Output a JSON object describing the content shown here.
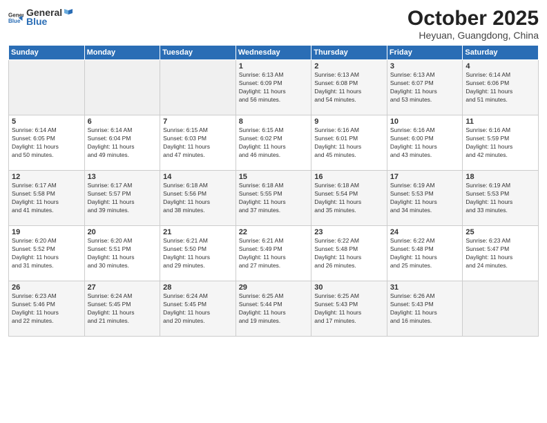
{
  "logo": {
    "general": "General",
    "blue": "Blue"
  },
  "header": {
    "month": "October 2025",
    "location": "Heyuan, Guangdong, China"
  },
  "weekdays": [
    "Sunday",
    "Monday",
    "Tuesday",
    "Wednesday",
    "Thursday",
    "Friday",
    "Saturday"
  ],
  "weeks": [
    [
      {
        "num": "",
        "info": ""
      },
      {
        "num": "",
        "info": ""
      },
      {
        "num": "",
        "info": ""
      },
      {
        "num": "1",
        "info": "Sunrise: 6:13 AM\nSunset: 6:09 PM\nDaylight: 11 hours\nand 56 minutes."
      },
      {
        "num": "2",
        "info": "Sunrise: 6:13 AM\nSunset: 6:08 PM\nDaylight: 11 hours\nand 54 minutes."
      },
      {
        "num": "3",
        "info": "Sunrise: 6:13 AM\nSunset: 6:07 PM\nDaylight: 11 hours\nand 53 minutes."
      },
      {
        "num": "4",
        "info": "Sunrise: 6:14 AM\nSunset: 6:06 PM\nDaylight: 11 hours\nand 51 minutes."
      }
    ],
    [
      {
        "num": "5",
        "info": "Sunrise: 6:14 AM\nSunset: 6:05 PM\nDaylight: 11 hours\nand 50 minutes."
      },
      {
        "num": "6",
        "info": "Sunrise: 6:14 AM\nSunset: 6:04 PM\nDaylight: 11 hours\nand 49 minutes."
      },
      {
        "num": "7",
        "info": "Sunrise: 6:15 AM\nSunset: 6:03 PM\nDaylight: 11 hours\nand 47 minutes."
      },
      {
        "num": "8",
        "info": "Sunrise: 6:15 AM\nSunset: 6:02 PM\nDaylight: 11 hours\nand 46 minutes."
      },
      {
        "num": "9",
        "info": "Sunrise: 6:16 AM\nSunset: 6:01 PM\nDaylight: 11 hours\nand 45 minutes."
      },
      {
        "num": "10",
        "info": "Sunrise: 6:16 AM\nSunset: 6:00 PM\nDaylight: 11 hours\nand 43 minutes."
      },
      {
        "num": "11",
        "info": "Sunrise: 6:16 AM\nSunset: 5:59 PM\nDaylight: 11 hours\nand 42 minutes."
      }
    ],
    [
      {
        "num": "12",
        "info": "Sunrise: 6:17 AM\nSunset: 5:58 PM\nDaylight: 11 hours\nand 41 minutes."
      },
      {
        "num": "13",
        "info": "Sunrise: 6:17 AM\nSunset: 5:57 PM\nDaylight: 11 hours\nand 39 minutes."
      },
      {
        "num": "14",
        "info": "Sunrise: 6:18 AM\nSunset: 5:56 PM\nDaylight: 11 hours\nand 38 minutes."
      },
      {
        "num": "15",
        "info": "Sunrise: 6:18 AM\nSunset: 5:55 PM\nDaylight: 11 hours\nand 37 minutes."
      },
      {
        "num": "16",
        "info": "Sunrise: 6:18 AM\nSunset: 5:54 PM\nDaylight: 11 hours\nand 35 minutes."
      },
      {
        "num": "17",
        "info": "Sunrise: 6:19 AM\nSunset: 5:53 PM\nDaylight: 11 hours\nand 34 minutes."
      },
      {
        "num": "18",
        "info": "Sunrise: 6:19 AM\nSunset: 5:53 PM\nDaylight: 11 hours\nand 33 minutes."
      }
    ],
    [
      {
        "num": "19",
        "info": "Sunrise: 6:20 AM\nSunset: 5:52 PM\nDaylight: 11 hours\nand 31 minutes."
      },
      {
        "num": "20",
        "info": "Sunrise: 6:20 AM\nSunset: 5:51 PM\nDaylight: 11 hours\nand 30 minutes."
      },
      {
        "num": "21",
        "info": "Sunrise: 6:21 AM\nSunset: 5:50 PM\nDaylight: 11 hours\nand 29 minutes."
      },
      {
        "num": "22",
        "info": "Sunrise: 6:21 AM\nSunset: 5:49 PM\nDaylight: 11 hours\nand 27 minutes."
      },
      {
        "num": "23",
        "info": "Sunrise: 6:22 AM\nSunset: 5:48 PM\nDaylight: 11 hours\nand 26 minutes."
      },
      {
        "num": "24",
        "info": "Sunrise: 6:22 AM\nSunset: 5:48 PM\nDaylight: 11 hours\nand 25 minutes."
      },
      {
        "num": "25",
        "info": "Sunrise: 6:23 AM\nSunset: 5:47 PM\nDaylight: 11 hours\nand 24 minutes."
      }
    ],
    [
      {
        "num": "26",
        "info": "Sunrise: 6:23 AM\nSunset: 5:46 PM\nDaylight: 11 hours\nand 22 minutes."
      },
      {
        "num": "27",
        "info": "Sunrise: 6:24 AM\nSunset: 5:45 PM\nDaylight: 11 hours\nand 21 minutes."
      },
      {
        "num": "28",
        "info": "Sunrise: 6:24 AM\nSunset: 5:45 PM\nDaylight: 11 hours\nand 20 minutes."
      },
      {
        "num": "29",
        "info": "Sunrise: 6:25 AM\nSunset: 5:44 PM\nDaylight: 11 hours\nand 19 minutes."
      },
      {
        "num": "30",
        "info": "Sunrise: 6:25 AM\nSunset: 5:43 PM\nDaylight: 11 hours\nand 17 minutes."
      },
      {
        "num": "31",
        "info": "Sunrise: 6:26 AM\nSunset: 5:43 PM\nDaylight: 11 hours\nand 16 minutes."
      },
      {
        "num": "",
        "info": ""
      }
    ]
  ]
}
